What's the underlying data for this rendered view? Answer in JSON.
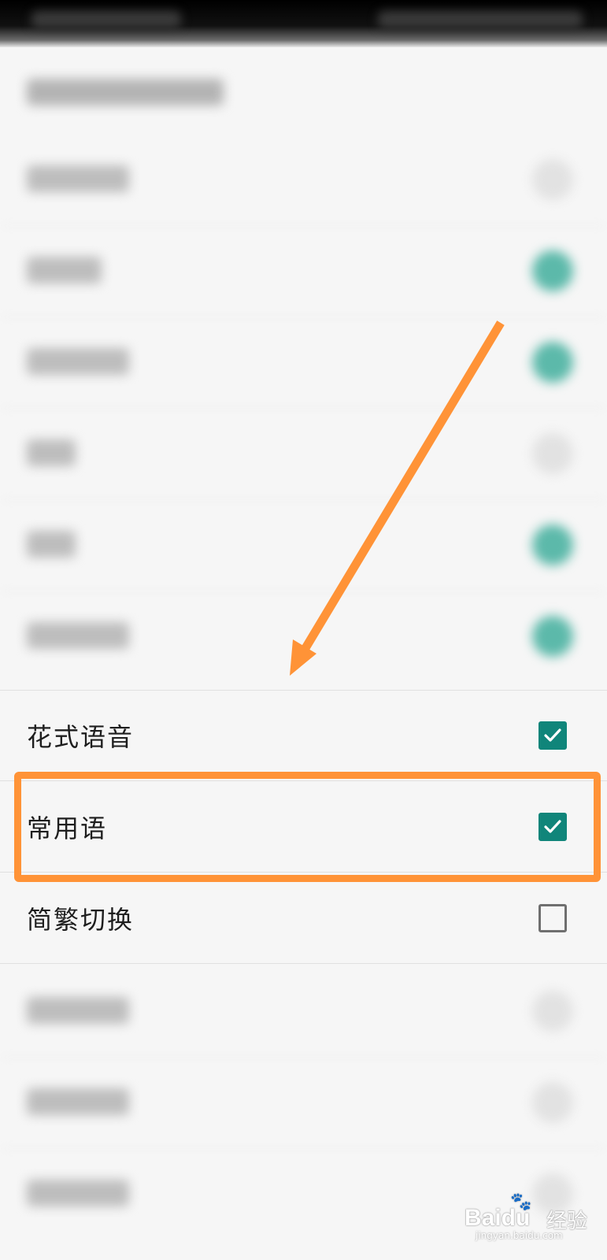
{
  "settings": {
    "items": [
      {
        "label": "花式语音",
        "checked": true
      },
      {
        "label": "常用语",
        "checked": true
      },
      {
        "label": "简繁切换",
        "checked": false
      }
    ]
  },
  "annotation": {
    "arrow_color": "#ff9337",
    "highlight_color": "#ff9337",
    "highlighted_item": "常用语"
  },
  "colors": {
    "accent": "#10857a",
    "checkbox_unchecked": "#6f6f6f"
  },
  "watermark": {
    "brand": "Baidu",
    "brand_cn": "经验",
    "url": "jingyan.baidu.com"
  }
}
